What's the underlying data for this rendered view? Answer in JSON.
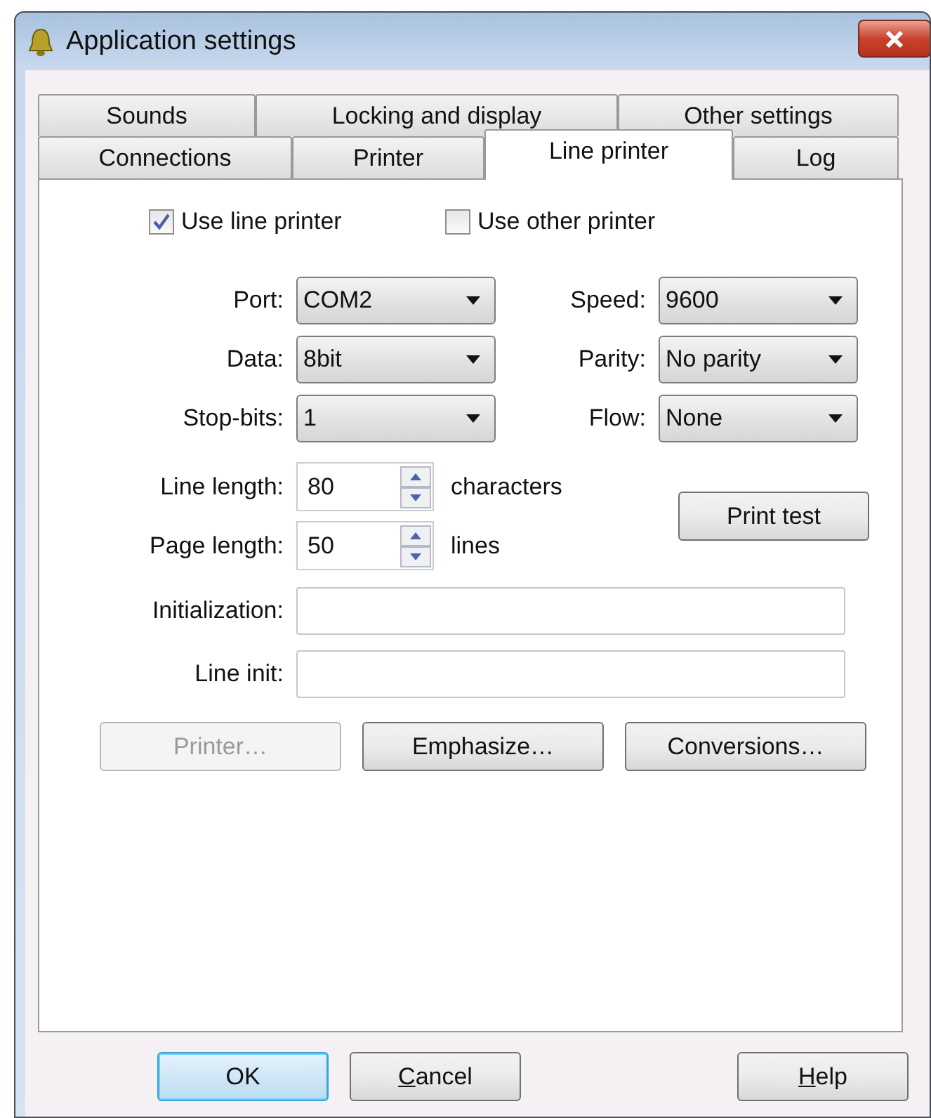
{
  "window": {
    "title": "Application settings"
  },
  "tab_rows": [
    {
      "tabs": [
        {
          "label": "Sounds",
          "selected": false
        },
        {
          "label": "Locking and display",
          "selected": false
        },
        {
          "label": "Other settings",
          "selected": false
        }
      ]
    },
    {
      "tabs": [
        {
          "label": "Connections",
          "selected": false
        },
        {
          "label": "Printer",
          "selected": false
        },
        {
          "label": "Line printer",
          "selected": true
        },
        {
          "label": "Log",
          "selected": false
        }
      ]
    }
  ],
  "checkboxes": [
    {
      "label": "Use line printer",
      "checked": true
    },
    {
      "label": "Use other printer",
      "checked": false
    }
  ],
  "selects": [
    {
      "label": "Port:",
      "value": "COM2"
    },
    {
      "label": "Speed:",
      "value": "9600"
    },
    {
      "label": "Data:",
      "value": "8bit"
    },
    {
      "label": "Parity:",
      "value": "No parity"
    },
    {
      "label": "Stop-bits:",
      "value": "1"
    },
    {
      "label": "Flow:",
      "value": "None"
    }
  ],
  "spinners": [
    {
      "label": "Line length:",
      "value": "80",
      "unit": "characters"
    },
    {
      "label": "Page length:",
      "value": "50",
      "unit": "lines"
    }
  ],
  "print_test_button": "Print test",
  "text_fields": [
    {
      "label": "Initialization:"
    },
    {
      "label": "Line init:"
    }
  ],
  "action_buttons": [
    {
      "label": "Printer…",
      "disabled": true
    },
    {
      "label": "Emphasize…",
      "disabled": false
    },
    {
      "label": "Conversions…",
      "disabled": false
    }
  ],
  "dialog_buttons": [
    {
      "label": "OK",
      "default": true
    },
    {
      "access_key": "C",
      "label": "ancel",
      "default": false
    },
    {
      "access_key": "H",
      "label": "elp",
      "default": false
    }
  ]
}
